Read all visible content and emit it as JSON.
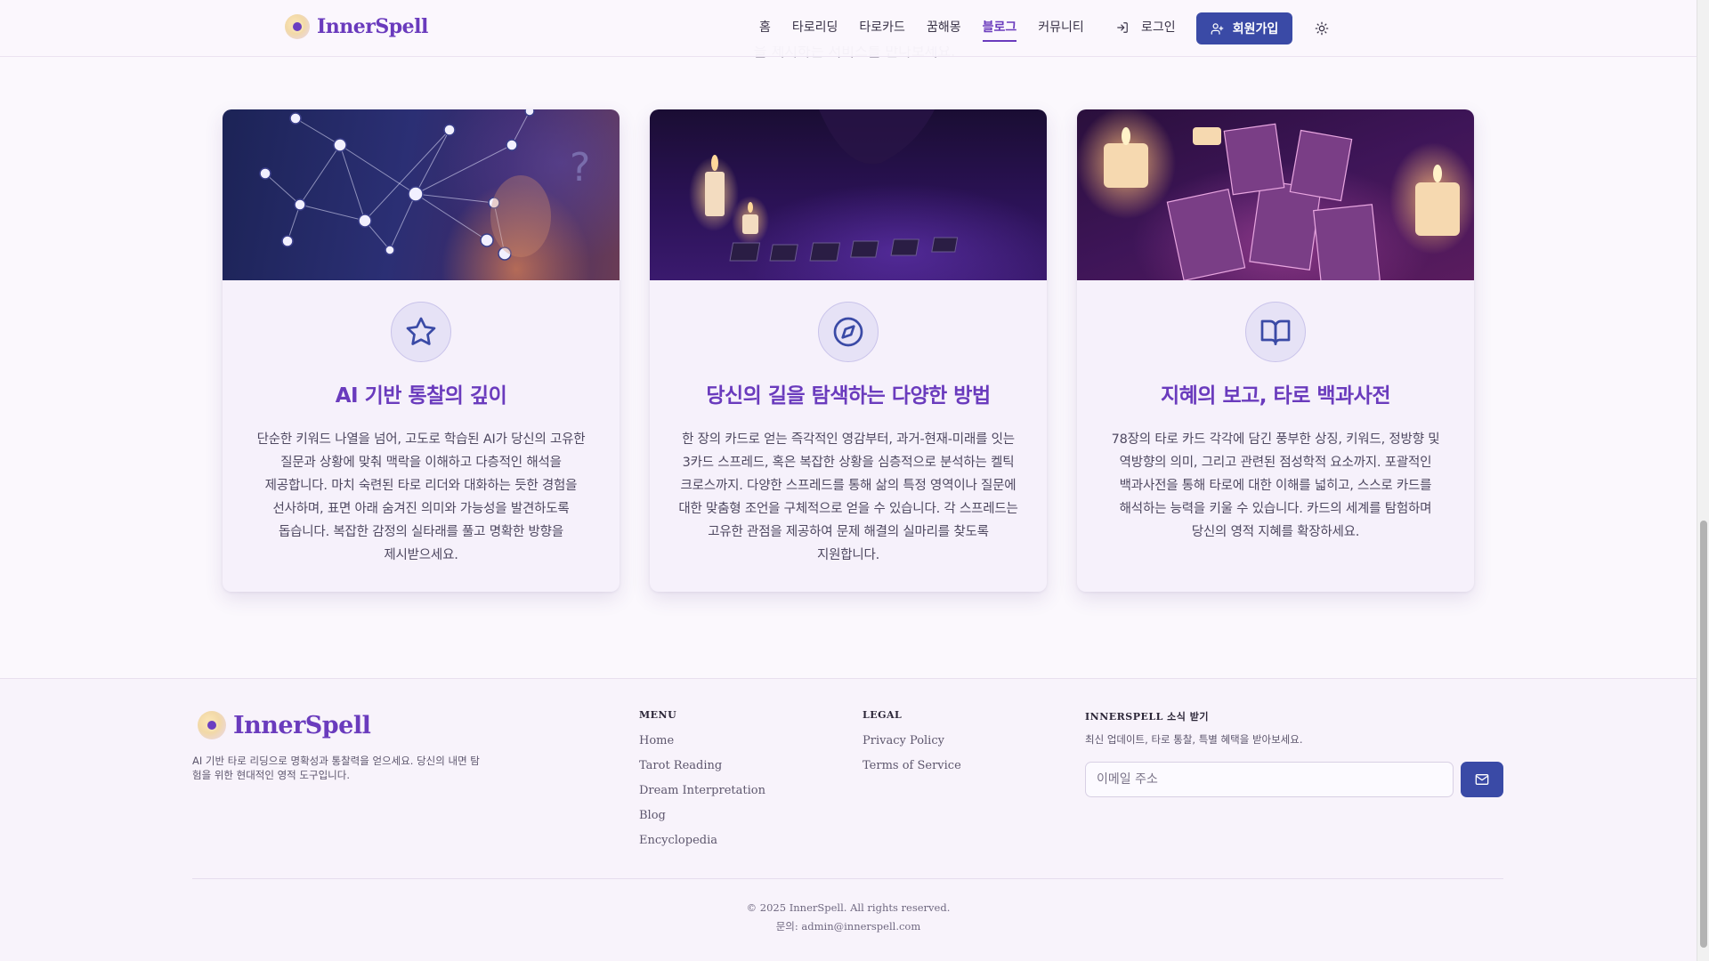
{
  "header": {
    "brand": "InnerSpell",
    "nav": [
      {
        "label": "홈",
        "active": false
      },
      {
        "label": "타로리딩",
        "active": false
      },
      {
        "label": "타로카드",
        "active": false
      },
      {
        "label": "꿈해몽",
        "active": false
      },
      {
        "label": "블로그",
        "active": true
      },
      {
        "label": "커뮤니티",
        "active": false
      }
    ],
    "login_label": "로그인",
    "signup_label": "회원가입",
    "icons": {
      "login": "log-in-icon",
      "signup": "user-plus-icon",
      "theme": "sun-icon"
    },
    "partial_text": "을 제시하는 서비스를 만나보세요."
  },
  "features": [
    {
      "icon": "star-icon",
      "title": "AI 기반 통찰의 깊이",
      "description": "단순한 키워드 나열을 넘어, 고도로 학습된 AI가 당신의 고유한 질문과 상황에 맞춰 맥락을 이해하고 다층적인 해석을 제공합니다. 마치 숙련된 타로 리더와 대화하는 듯한 경험을 선사하며, 표면 아래 숨겨진 의미와 가능성을 발견하도록 돕습니다. 복잡한 감정의 실타래를 풀고 명확한 방향을 제시받으세요."
    },
    {
      "icon": "compass-icon",
      "title": "당신의 길을 탐색하는 다양한 방법",
      "description": "한 장의 카드로 얻는 즉각적인 영감부터, 과거-현재-미래를 잇는 3카드 스프레드, 혹은 복잡한 상황을 심층적으로 분석하는 켈틱 크로스까지. 다양한 스프레드를 통해 삶의 특정 영역이나 질문에 대한 맞춤형 조언을 구체적으로 얻을 수 있습니다. 각 스프레드는 고유한 관점을 제공하여 문제 해결의 실마리를 찾도록 지원합니다."
    },
    {
      "icon": "open-book-icon",
      "title": "지혜의 보고, 타로 백과사전",
      "description": "78장의 타로 카드 각각에 담긴 풍부한 상징, 키워드, 정방향 및 역방향의 의미, 그리고 관련된 점성학적 요소까지. 포괄적인 백과사전을 통해 타로에 대한 이해를 넓히고, 스스로 카드를 해석하는 능력을 키울 수 있습니다. 카드의 세계를 탐험하며 당신의 영적 지혜를 확장하세요."
    }
  ],
  "footer": {
    "brand": "InnerSpell",
    "tagline": "AI 기반 타로 리딩으로 명확성과 통찰력을 얻으세요. 당신의 내면 탐험을 위한 현대적인 영적 도구입니다.",
    "menu": {
      "title": "MENU",
      "links": [
        "Home",
        "Tarot Reading",
        "Dream Interpretation",
        "Blog",
        "Encyclopedia"
      ]
    },
    "legal": {
      "title": "LEGAL",
      "links": [
        "Privacy Policy",
        "Terms of Service"
      ]
    },
    "newsletter": {
      "title": "INNERSPELL 소식 받기",
      "description": "최신 업데이트, 타로 통찰, 특별 혜택을 받아보세요.",
      "email_value": "",
      "email_placeholder": "이메일 주소",
      "submit_icon": "mail-icon"
    },
    "copyright": "© 2025 InnerSpell. All rights reserved.",
    "contact": "문의: admin@innerspell.com"
  },
  "colors": {
    "brand": "#6a3bbd",
    "primary_button": "#3a4aa6",
    "background": "#fbf8fd"
  }
}
